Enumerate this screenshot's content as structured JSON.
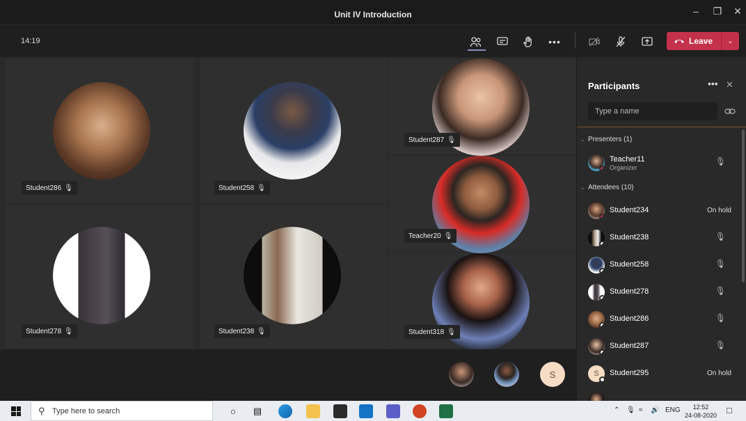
{
  "window": {
    "title": "Unit IV Introduction",
    "controls": [
      "minimize-icon",
      "restore-icon",
      "close-icon"
    ]
  },
  "toolbar": {
    "time": "14:19",
    "leave_label": "Leave",
    "icons": [
      "people-icon",
      "chat-icon",
      "raise-hand-icon",
      "more-icon",
      "camera-off-icon",
      "mic-off-icon",
      "share-screen-icon",
      "phone-icon",
      "chevron-down-icon"
    ]
  },
  "tiles": [
    {
      "name": "Student286"
    },
    {
      "name": "Student258"
    },
    {
      "name": "Student287"
    },
    {
      "name": "Student278"
    },
    {
      "name": "Student238"
    },
    {
      "name": "Teacher20"
    },
    {
      "name": "Student318"
    }
  ],
  "bottom_row": {
    "initial": "S"
  },
  "participants": {
    "title": "Participants",
    "search_placeholder": "Type a name",
    "presenters_label": "Presenters (1)",
    "attendees_label": "Attendees (10)",
    "presenters": [
      {
        "name": "Teacher11",
        "role": "Organizer"
      }
    ],
    "attendees": [
      {
        "name": "Student234",
        "status": "On hold"
      },
      {
        "name": "Student238",
        "status": ""
      },
      {
        "name": "Student258",
        "status": ""
      },
      {
        "name": "Student278",
        "status": ""
      },
      {
        "name": "Student286",
        "status": ""
      },
      {
        "name": "Student287",
        "status": ""
      },
      {
        "name": "Student295",
        "status": "On hold",
        "initial": "S"
      }
    ]
  },
  "taskbar": {
    "search_placeholder": "Type here to search",
    "lang": "ENG",
    "time": "12:52",
    "date": "24-08-2020"
  },
  "colors": {
    "leave": "#c4314b",
    "accent": "#8b8cc7",
    "panel": "#292929"
  }
}
